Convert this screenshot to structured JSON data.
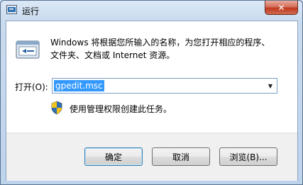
{
  "window": {
    "title": "运行",
    "close_label": "✕"
  },
  "description": {
    "line1": "Windows 将根据您所输入的名称，为您打开相应的程序、",
    "line2": "文件夹、文档或 Internet 资源。"
  },
  "open": {
    "label": "打开(O):",
    "value": "gpedit.msc",
    "arrow": "▼"
  },
  "admin_notice": "使用管理权限创建此任务。",
  "buttons": {
    "ok": "确定",
    "cancel": "取消",
    "browse": "浏览(B)..."
  },
  "icons": {
    "window_icon": "run-app-icon",
    "run_icon": "run-window-icon",
    "shield_icon": "uac-shield-icon",
    "close_icon": "close-icon",
    "dropdown_icon": "chevron-down-icon"
  },
  "colors": {
    "selection": "#3399ff",
    "close_button": "#c0391f"
  }
}
